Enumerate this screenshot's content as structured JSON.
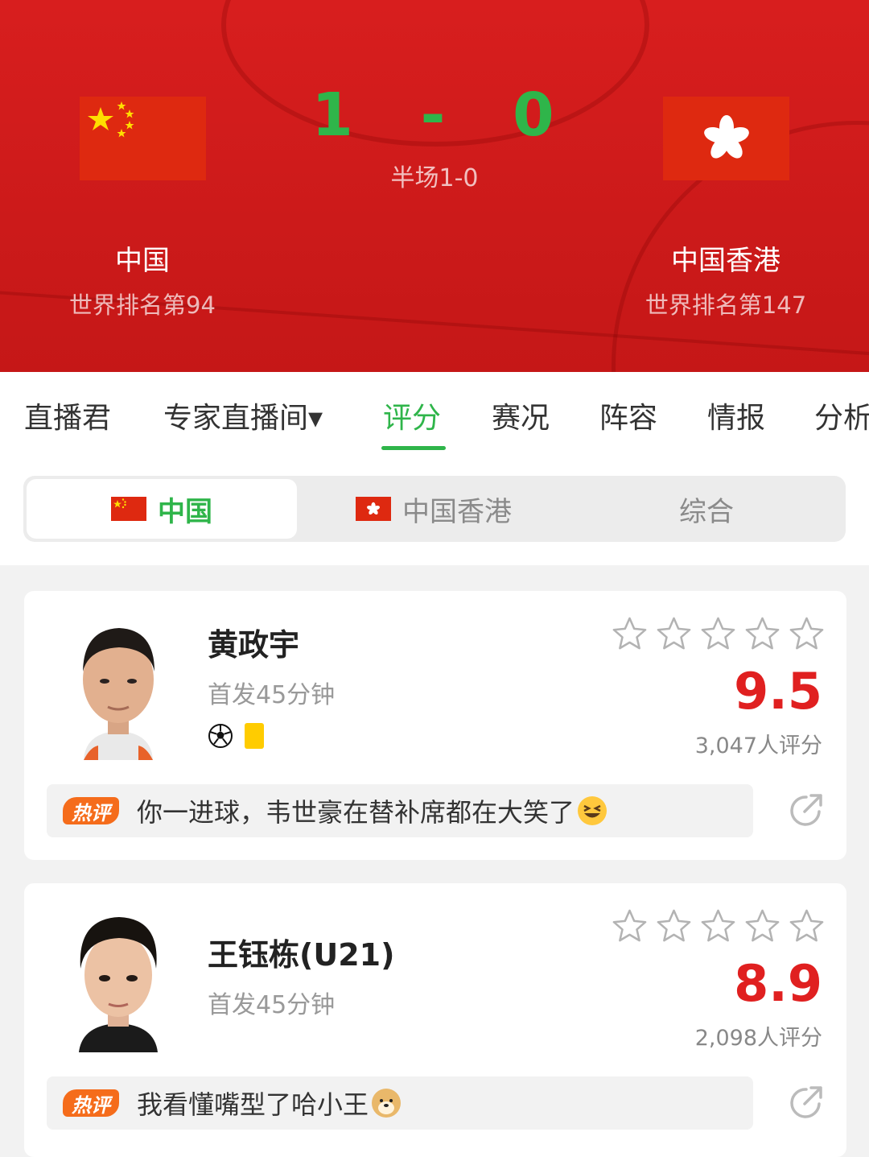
{
  "match": {
    "score_home": "1",
    "score_sep": "-",
    "score_away": "0",
    "half_time": "半场1-0",
    "home": {
      "name": "中国",
      "rank": "世界排名第94"
    },
    "away": {
      "name": "中国香港",
      "rank": "世界排名第147"
    }
  },
  "tabs": [
    {
      "label": "直播君"
    },
    {
      "label": "专家直播间▾"
    },
    {
      "label": "评分"
    },
    {
      "label": "赛况"
    },
    {
      "label": "阵容"
    },
    {
      "label": "情报"
    },
    {
      "label": "分析"
    }
  ],
  "active_tab": "评分",
  "segments": [
    {
      "label": "中国"
    },
    {
      "label": "中国香港"
    },
    {
      "label": "综合"
    }
  ],
  "players": [
    {
      "name": "黄政宇",
      "meta": "首发45分钟",
      "rating": "9.5",
      "votes": "3,047人评分",
      "stars": 0,
      "hot_label": "热评",
      "comment": "你一进球，韦世豪在替补席都在大笑了",
      "events": [
        "goal-icon",
        "yellow-card-icon"
      ]
    },
    {
      "name": "王钰栋(U21)",
      "meta": "首发45分钟",
      "rating": "8.9",
      "votes": "2,098人评分",
      "stars": 0,
      "hot_label": "热评",
      "comment": "我看懂嘴型了哈小王",
      "events": []
    }
  ],
  "colors": {
    "accent": "#2fb54a",
    "header_red": "#d81e1e",
    "rating_red": "#e02020",
    "hot_orange": "#f56c1b"
  }
}
